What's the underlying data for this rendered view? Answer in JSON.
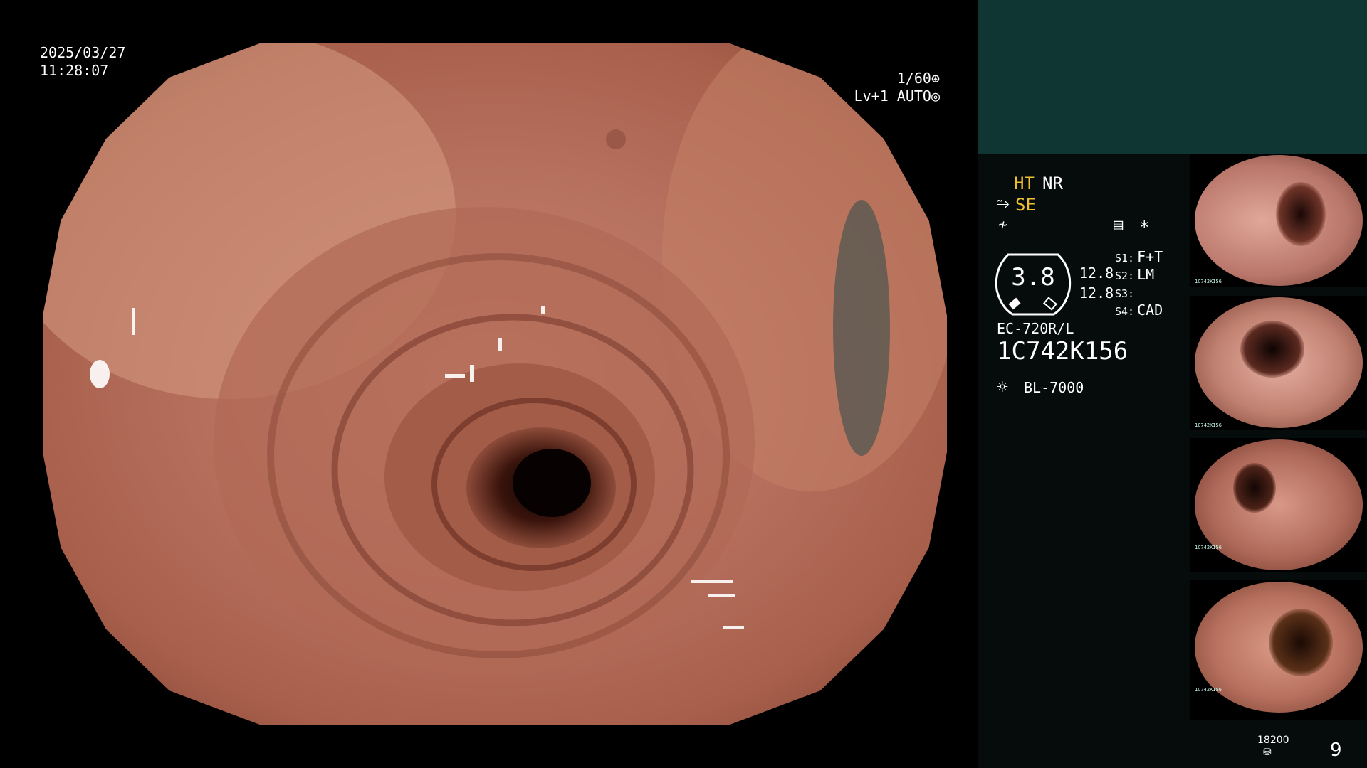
{
  "overlay": {
    "date": "2025/03/27",
    "time": "11:28:07",
    "shutter": "1/60",
    "level": "Lv+1 AUTO"
  },
  "panel": {
    "ht": "HT",
    "nr": "NR",
    "se": "SE",
    "enhancement_icon": "structure-enhancement-icon",
    "color_icon": "color-mode-icon",
    "menu_icon": "settings-icon",
    "star": "*",
    "gauge_value": "3.8",
    "num1": "12.8",
    "num2": "12.8",
    "slots": [
      {
        "key": "S1:",
        "value": "F+T"
      },
      {
        "key": "S2:",
        "value": "LM"
      },
      {
        "key": "S3:",
        "value": ""
      },
      {
        "key": "S4:",
        "value": "CAD"
      }
    ],
    "scope_model": "EC-720R/L",
    "serial": "1C742K156",
    "light_source": "BL-7000",
    "storage_count": "18200",
    "image_count": "9",
    "colors": {
      "yellow": "#f0c030",
      "panel_top": "#103634",
      "panel_bg": "#050c0b"
    }
  },
  "thumbnails": [
    {
      "serial": "1C742K156"
    },
    {
      "serial": "1C742K156"
    },
    {
      "serial": "1C742K156"
    },
    {
      "serial": "1C742K156"
    }
  ]
}
